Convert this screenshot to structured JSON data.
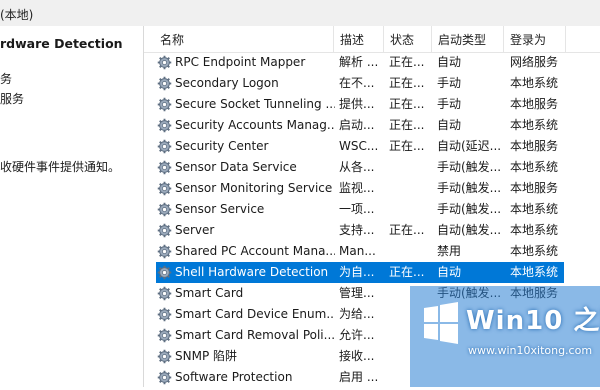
{
  "window": {
    "title_fragment": "(本地)"
  },
  "left_pane": {
    "service_title": "rdware Detection",
    "line1": "务",
    "line2": "服务",
    "description": "收硬件事件提供通知。"
  },
  "columns": [
    "名称",
    "描述",
    "状态",
    "启动类型",
    "登录为"
  ],
  "rows": [
    {
      "name": "RPC Endpoint Mapper",
      "desc": "解析 ...",
      "status": "正在...",
      "start": "自动",
      "logon": "网络服务",
      "selected": false
    },
    {
      "name": "Secondary Logon",
      "desc": "在不...",
      "status": "正在...",
      "start": "手动",
      "logon": "本地系统",
      "selected": false
    },
    {
      "name": "Secure Socket Tunneling ...",
      "desc": "提供...",
      "status": "正在...",
      "start": "手动",
      "logon": "本地服务",
      "selected": false
    },
    {
      "name": "Security Accounts Manag...",
      "desc": "启动...",
      "status": "正在...",
      "start": "自动",
      "logon": "本地系统",
      "selected": false
    },
    {
      "name": "Security Center",
      "desc": "WSC...",
      "status": "正在...",
      "start": "自动(延迟...",
      "logon": "本地服务",
      "selected": false
    },
    {
      "name": "Sensor Data Service",
      "desc": "从各...",
      "status": "",
      "start": "手动(触发...",
      "logon": "本地系统",
      "selected": false
    },
    {
      "name": "Sensor Monitoring Service",
      "desc": "监视...",
      "status": "",
      "start": "手动(触发...",
      "logon": "本地服务",
      "selected": false
    },
    {
      "name": "Sensor Service",
      "desc": "一项...",
      "status": "",
      "start": "手动(触发...",
      "logon": "本地系统",
      "selected": false
    },
    {
      "name": "Server",
      "desc": "支持...",
      "status": "正在...",
      "start": "自动(触发...",
      "logon": "本地系统",
      "selected": false
    },
    {
      "name": "Shared PC Account Mana...",
      "desc": "Man...",
      "status": "",
      "start": "禁用",
      "logon": "本地系统",
      "selected": false
    },
    {
      "name": "Shell Hardware Detection",
      "desc": "为自...",
      "status": "正在...",
      "start": "自动",
      "logon": "本地系统",
      "selected": true
    },
    {
      "name": "Smart Card",
      "desc": "管理...",
      "status": "",
      "start": "手动(触发...",
      "logon": "本地服务",
      "selected": false
    },
    {
      "name": "Smart Card Device Enum...",
      "desc": "为给...",
      "status": "",
      "start": "",
      "logon": "",
      "selected": false
    },
    {
      "name": "Smart Card Removal Poli...",
      "desc": "允许...",
      "status": "",
      "start": "",
      "logon": "",
      "selected": false
    },
    {
      "name": "SNMP 陷阱",
      "desc": "接收...",
      "status": "",
      "start": "",
      "logon": "",
      "selected": false
    },
    {
      "name": "Software Protection",
      "desc": "启用 ...",
      "status": "",
      "start": "",
      "logon": "",
      "selected": false
    }
  ],
  "watermark": {
    "brand": "Win10 之家",
    "url": "www.win10xitong.com"
  },
  "colors": {
    "selection": "#0078d7",
    "accent": "#2a7fd4"
  }
}
